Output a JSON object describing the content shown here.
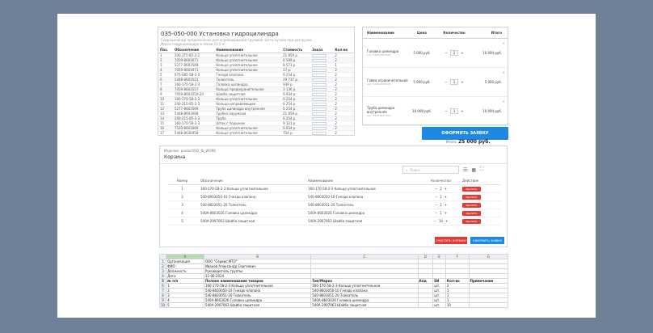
{
  "parts": {
    "title": "035-050-000 Установка гидроцилиндра",
    "desc1": "Гидроцилиндр предназначен для опрокидывания грузовой части кузова при разгрузке.",
    "desc2": "Масса гидроцилиндра в сборе 23,5 кг.",
    "headers": [
      "Поз.",
      "Обозначение",
      "Наименование",
      "Стоимость",
      "Заказ",
      "Кол-во"
    ],
    "rows": [
      [
        "1",
        "200-2Т5-85-2-2",
        "Кольцо уплотнительное",
        "21 859 р.",
        "",
        "2"
      ],
      [
        "2",
        "7059-8603071",
        "Кольцо уплотнительное",
        "6 589 р.",
        "",
        "2"
      ],
      [
        "3",
        "5277-8603569",
        "Кольцо уплотнительное",
        "8 573 р.",
        "",
        "1"
      ],
      [
        "4",
        "7059-8603071",
        "Кольцо уплотнительное",
        "17 р.",
        "",
        "2"
      ],
      [
        "5",
        "075-085-58-2-3",
        "Гнездо клапана",
        "6 254 р.",
        "",
        "2"
      ],
      [
        "6",
        "5448-8603521",
        "Толкатель",
        "19 737 р.",
        "",
        "2"
      ],
      [
        "7",
        "160-170-58-2-3",
        "Головка цилиндра",
        "939 р.",
        "",
        "2"
      ],
      [
        "8",
        "7059-8603557",
        "Кольцо предохранительное",
        "3 136 р.",
        "",
        "2"
      ],
      [
        "9",
        "7059-8603559-20",
        "Шайба защитная",
        "6 934 р.",
        "",
        "2"
      ],
      [
        "10",
        "160-170-58-2-3",
        "Кольцо уплотнительное",
        "6 254 р.",
        "",
        "2"
      ],
      [
        "11",
        "200-215-85-2-3",
        "Кольцо направляющее",
        "6 254 р.",
        "",
        "2"
      ],
      [
        "12",
        "5277-8603569",
        "Трубе цилиндра внутренняя",
        "6 254 р.",
        "",
        "2"
      ],
      [
        "13",
        "5448-8603068",
        "Трубка наружная",
        "21 859 р.",
        "",
        "2"
      ],
      [
        "14",
        "200-215-85-2-3",
        "Труба",
        "6 254 р.",
        "",
        "2"
      ],
      [
        "15",
        "160-170-58-2-3",
        "Шток с поршнем",
        "9 121 р.",
        "",
        "2"
      ],
      [
        "16",
        "7520-8603069",
        "Кольцо уплотнительное",
        "6 934 р.",
        "",
        "2"
      ],
      [
        "17",
        "5448-8630058",
        "Кольцо уплотнительное",
        "754 р.",
        "",
        "2"
      ],
      [
        "18",
        "7059-8603071-10",
        "Кольцо уплотнительное",
        "1 012 р.",
        "",
        "2"
      ],
      [
        "19",
        "7059-8603057",
        "Кольцо уплотнительное",
        "2 856 р.",
        "",
        "2"
      ]
    ]
  },
  "cart": {
    "headers": [
      "Наименование",
      "Цена",
      "Количество",
      "Итого"
    ],
    "items": [
      {
        "name": "Головка цилиндра",
        "sub": "арт. 5408-8603026",
        "price": "5 000 руб.",
        "qty": "2",
        "total": "10 000 руб."
      },
      {
        "name": "Гайка ограничительная",
        "sub": "арт. 5408-8603026",
        "price": "5 000 руб.",
        "qty": "1",
        "total": "5 000 руб."
      },
      {
        "name": "Труба цилиндра внутренняя",
        "sub": "арт. 5408-8603026",
        "price": "10 000 руб.",
        "qty": "1",
        "total": "10 000 руб."
      }
    ],
    "total_label": "Итого:",
    "total_value": "25 000 руб.",
    "order_label": "ОФОРМИТЬ ЗАЯВКУ",
    "close": "×",
    "minus": "−",
    "plus": "+"
  },
  "basket": {
    "user": "Изделие: product002_fb_WORK",
    "title": "Корзина",
    "search_placeholder": "Поиск",
    "headers": [
      "Номер",
      "Обозначение",
      "Наименование",
      "Количество",
      "Действие"
    ],
    "rows": [
      [
        "1",
        "160-170-58-2-3 Кольцо уплотнительное",
        "160-170-58-2-3 Кольцо уплотнительное",
        "2"
      ],
      [
        "2",
        "540-8603050-10 Гнездо клапана",
        "540-8603050-10 Гнездо клапана",
        "1"
      ],
      [
        "3",
        "540-8603051-20 Толкатель",
        "540-8603051-20 Толкатель",
        "1"
      ],
      [
        "4",
        "540А-8603026 Головка цилиндра",
        "540А-8603026 Головка цилиндра",
        "1"
      ],
      [
        "5",
        "540А-2907063 Шайба защитная",
        "540А-2907063 Шайба защитная",
        "10"
      ]
    ],
    "delete_label": "УДАЛИТЬ",
    "clear_label": "ОЧИСТИТЬ КОРЗИНУ",
    "submit_label": "ОФОРМИТЬ ЗАЯВКУ"
  },
  "sheet": {
    "cols": [
      "",
      "A",
      "B",
      "C",
      "D",
      "E",
      "F",
      "G"
    ],
    "rows": [
      [
        "1",
        "Организация",
        "ООО \"Сервис МТО\"",
        "",
        "",
        "",
        "",
        ""
      ],
      [
        "2",
        "ФИО",
        "Иванов Александр Сергеевич",
        "",
        "",
        "",
        "",
        ""
      ],
      [
        "3",
        "Должность",
        "Руководитель группы",
        "",
        "",
        "",
        "",
        ""
      ],
      [
        "4",
        "Дата",
        "11-06-2024",
        "",
        "",
        "",
        "",
        ""
      ],
      [
        "5",
        "№ п/п",
        "Полное наименование товаров",
        "Тип/Марка",
        "Код",
        "ЕИ",
        "Кол-во",
        "Примечание"
      ],
      [
        "6",
        "1",
        "160-170-58-2-3 Кольцо уплотнительное",
        "160-170-58-2-3 Кольцо уплотнительное",
        "",
        "шт.",
        "2",
        ""
      ],
      [
        "7",
        "2",
        "540-8603050-10 Гнездо клапана",
        "540-8603050-10 Гнездо клапана",
        "",
        "шт.",
        "1",
        ""
      ],
      [
        "8",
        "3",
        "540-8603051-20 Толкатель",
        "540-8603051-20 Толкатель",
        "",
        "шт.",
        "1",
        ""
      ],
      [
        "9",
        "4",
        "540А-8603026 Головка цилиндра",
        "540А-8603026 Головка цилиндра",
        "",
        "шт.",
        "1",
        ""
      ],
      [
        "10",
        "5",
        "540А-2907063 Шайба защитная",
        "540А-2907063 Шайба защитная",
        "",
        "шт.",
        "10",
        ""
      ]
    ]
  }
}
